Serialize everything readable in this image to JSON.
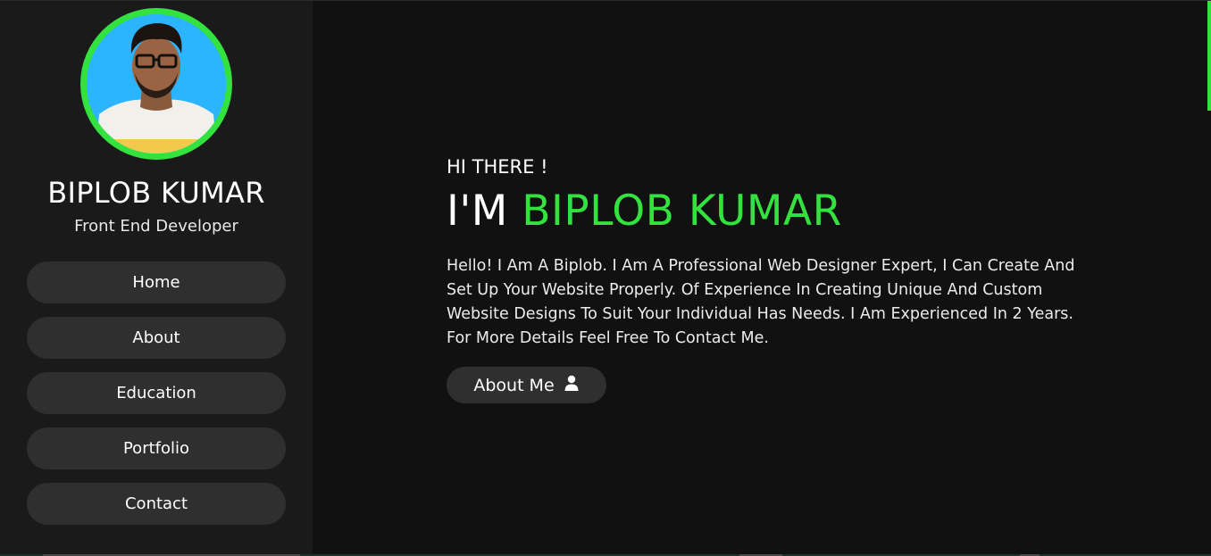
{
  "sidebar": {
    "name": "BIPLOB KUMAR",
    "role": "Front End Developer",
    "nav": [
      {
        "label": "Home"
      },
      {
        "label": "About"
      },
      {
        "label": "Education"
      },
      {
        "label": "Portfolio"
      },
      {
        "label": "Contact"
      }
    ]
  },
  "hero": {
    "greeting": "HI THERE !",
    "intro_prefix": "I'M",
    "intro_name": "BIPLOB KUMAR",
    "bio": "Hello! I Am A Biplob. I Am A Professional Web Designer Expert, I Can Create And Set Up Your Website Properly. Of Experience In Creating Unique And Custom Website Designs To Suit Your Individual Has Needs. I Am Experienced In 2 Years. For More Details Feel Free To Contact Me.",
    "button_label": "About Me",
    "button_icon": "user-icon"
  },
  "colors": {
    "accent": "#33e23f",
    "background": "#111112",
    "sidebar": "#1a1a1a",
    "button": "#2f2f2f"
  }
}
